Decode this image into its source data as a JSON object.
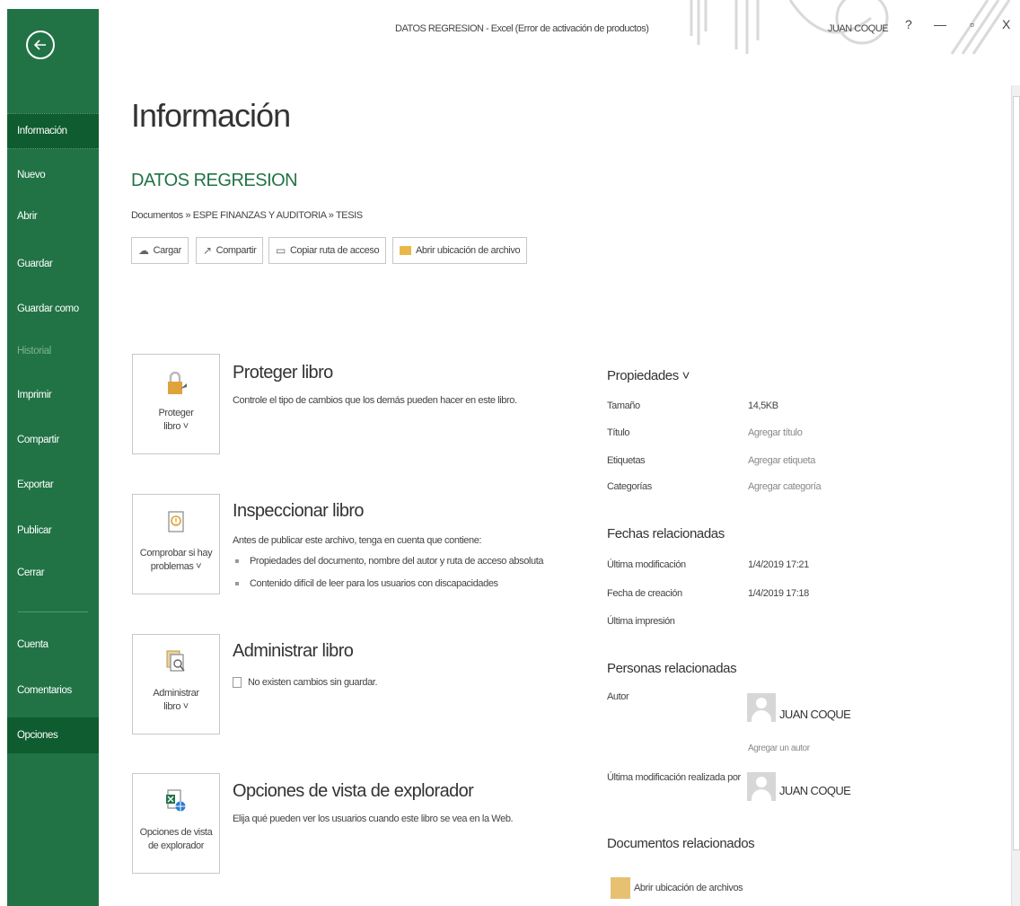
{
  "titlebar": {
    "text": "DATOS REGRESION  -  Excel (Error de activación de productos)",
    "user": "JUAN COQUE",
    "help": "?",
    "minimize": "—",
    "restore": "▫",
    "close": "X"
  },
  "sidebar": {
    "items": [
      {
        "label": "Información"
      },
      {
        "label": "Nuevo"
      },
      {
        "label": "Abrir"
      },
      {
        "label": "Guardar"
      },
      {
        "label": "Guardar como"
      },
      {
        "label": "Historial"
      },
      {
        "label": "Imprimir"
      },
      {
        "label": "Compartir"
      },
      {
        "label": "Exportar"
      },
      {
        "label": "Publicar"
      },
      {
        "label": "Cerrar"
      },
      {
        "label": "Cuenta"
      },
      {
        "label": "Comentarios"
      },
      {
        "label": "Opciones"
      }
    ]
  },
  "main": {
    "title": "Información",
    "file_name": "DATOS REGRESION",
    "breadcrumb": "Documentos » ESPE FINANZAS Y AUDITORIA » TESIS",
    "actions": {
      "upload": "Cargar",
      "share": "Compartir",
      "copy_path": "Copiar ruta de acceso",
      "open_location": "Abrir ubicación de archivo"
    }
  },
  "sections": {
    "protect": {
      "tile_label_1": "Proteger",
      "tile_label_2": "libro ˅",
      "title": "Proteger libro",
      "desc": "Controle el tipo de cambios que los demás pueden hacer en este libro."
    },
    "inspect": {
      "tile_label_1": "Comprobar si hay",
      "tile_label_2": "problemas ˅",
      "title": "Inspeccionar libro",
      "desc": "Antes de publicar este archivo, tenga en cuenta que contiene:",
      "bullet_1": "Propiedades del documento, nombre del autor y ruta de acceso absoluta",
      "bullet_2": "Contenido difícil de leer para los usuarios con discapacidades"
    },
    "manage": {
      "tile_label_1": "Administrar",
      "tile_label_2": "libro ˅",
      "title": "Administrar libro",
      "desc": "No existen cambios sin guardar."
    },
    "browser": {
      "tile_label_1": "Opciones de vista",
      "tile_label_2": "de explorador",
      "title": "Opciones de vista de explorador",
      "desc": "Elija qué pueden ver los usuarios cuando este libro se vea en la Web."
    }
  },
  "properties": {
    "heading": "Propiedades ˅",
    "size_label": "Tamaño",
    "size_value": "14,5KB",
    "title_label": "Título",
    "title_value": "Agregar título",
    "tags_label": "Etiquetas",
    "tags_value": "Agregar etiqueta",
    "categories_label": "Categorías",
    "categories_value": "Agregar categoría",
    "dates_heading": "Fechas relacionadas",
    "modified_label": "Última modificación",
    "modified_value": "1/4/2019 17:21",
    "created_label": "Fecha de creación",
    "created_value": "1/4/2019 17:18",
    "printed_label": "Última impresión",
    "people_heading": "Personas relacionadas",
    "author_label": "Autor",
    "author_name": "JUAN COQUE",
    "add_author": "Agregar un autor",
    "last_modified_by_label": "Última modificación realizada por",
    "last_modified_by_name": "JUAN COQUE",
    "docs_heading": "Documentos relacionados",
    "open_files_location": "Abrir ubicación de archivos"
  },
  "colors": {
    "brand": "#217346",
    "sidebar_active": "#0e5c2f"
  }
}
